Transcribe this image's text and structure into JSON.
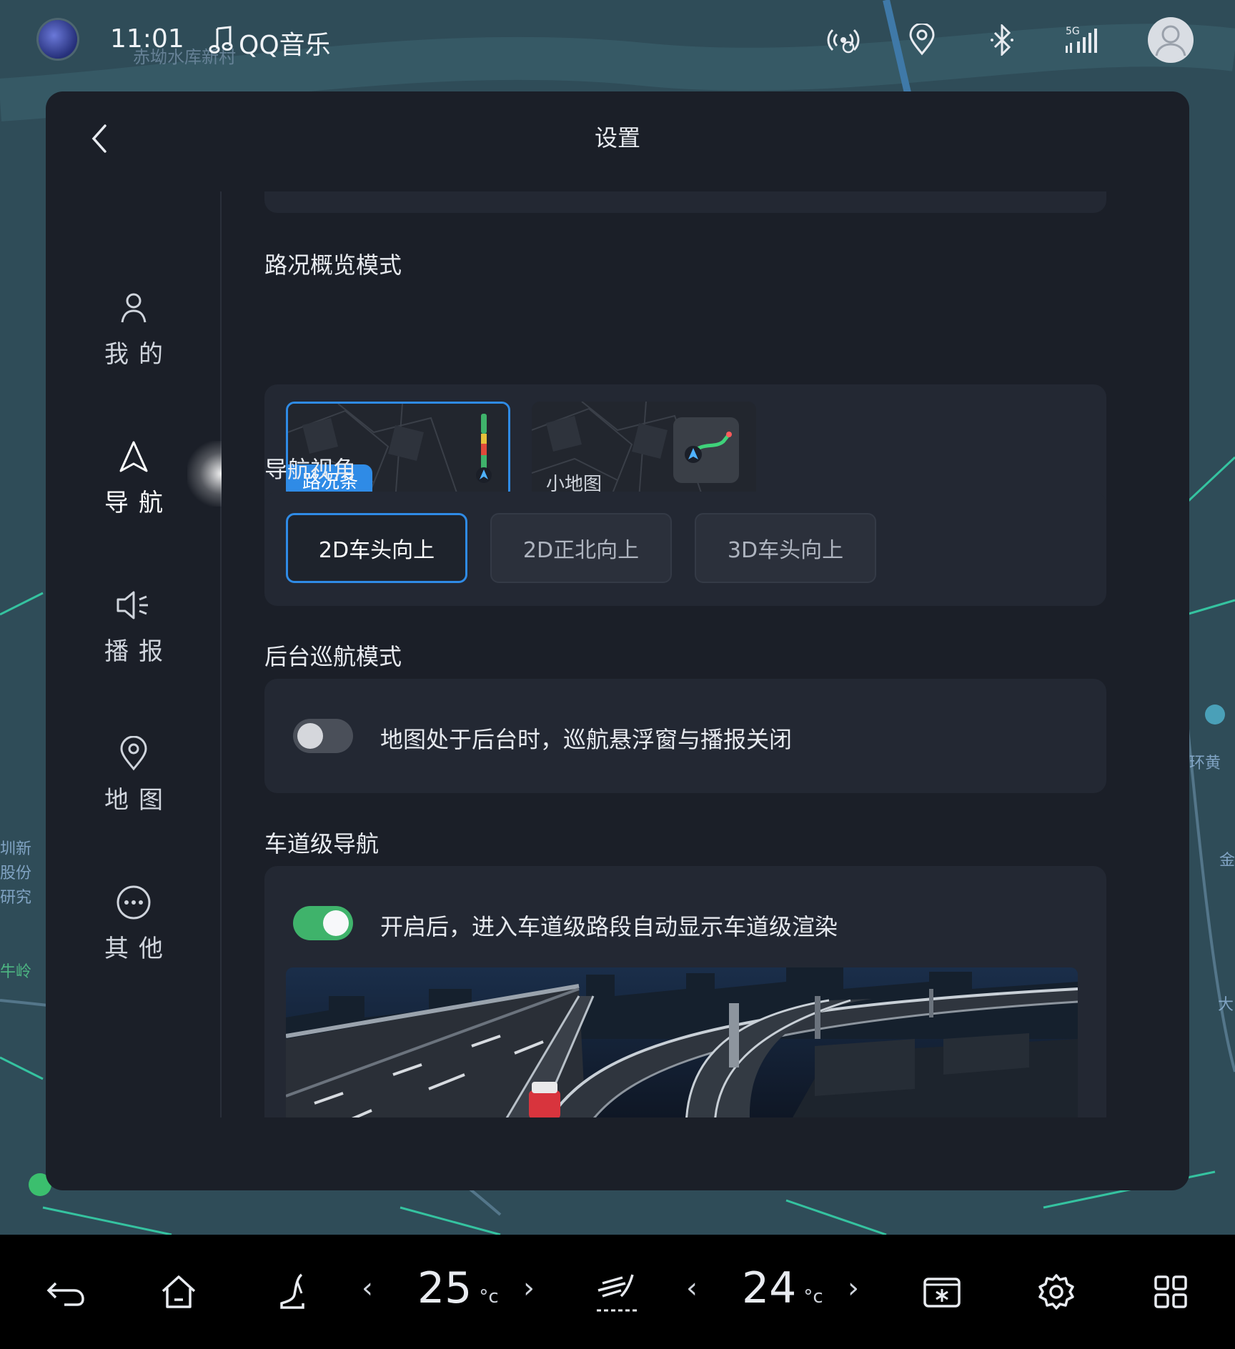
{
  "status_bar": {
    "time": "11:01",
    "music_app": "QQ音乐",
    "map_place_label": "赤坳水库新村",
    "signal_label": "5G",
    "icons": [
      "profile-avatar-icon",
      "music-note-icon",
      "hotspot-icon",
      "location-pin-icon",
      "bluetooth-icon",
      "signal-5g-icon",
      "user-avatar-icon"
    ]
  },
  "map": {
    "labels": [
      "圳新",
      "股份",
      "研究",
      "牛岭",
      "环黄",
      "金",
      "大"
    ]
  },
  "panel": {
    "title": "设置",
    "back_icon": "back-chevron-icon"
  },
  "sidenav": {
    "items": [
      {
        "label": "我的",
        "icon": "person-icon"
      },
      {
        "label": "导航",
        "icon": "navigation-arrow-icon",
        "active": true
      },
      {
        "label": "播报",
        "icon": "speaker-icon"
      },
      {
        "label": "地图",
        "icon": "location-pin-icon"
      },
      {
        "label": "其他",
        "icon": "more-dots-icon"
      }
    ]
  },
  "sections": {
    "traffic_overview": {
      "title": "路况概览模式",
      "options": [
        {
          "label": "路况条",
          "selected": true
        },
        {
          "label": "小地图",
          "selected": false
        }
      ]
    },
    "nav_view": {
      "title": "导航视角",
      "options": [
        {
          "label": "2D车头向上",
          "selected": true
        },
        {
          "label": "2D正北向上",
          "selected": false
        },
        {
          "label": "3D车头向上",
          "selected": false
        }
      ]
    },
    "background_cruise": {
      "title": "后台巡航模式",
      "toggle_on": false,
      "description": "地图处于后台时，巡航悬浮窗与播报关闭"
    },
    "lane_nav": {
      "title": "车道级导航",
      "toggle_on": true,
      "description": "开启后，进入车道级路段自动显示车道级渲染"
    }
  },
  "dock": {
    "left_temp": "25",
    "right_temp": "24",
    "temp_unit": "°c",
    "arrow_left": "‹",
    "arrow_right": "›",
    "icons": [
      "back-arrow-icon",
      "home-icon",
      "seat-icon",
      "climate-fan-icon",
      "defrost-icon",
      "settings-gear-icon",
      "app-grid-icon"
    ]
  },
  "colors": {
    "accent": "#2f8be6",
    "toggle_on": "#3fb36b",
    "panel_bg": "#1b1f28",
    "card_bg": "#232833"
  }
}
